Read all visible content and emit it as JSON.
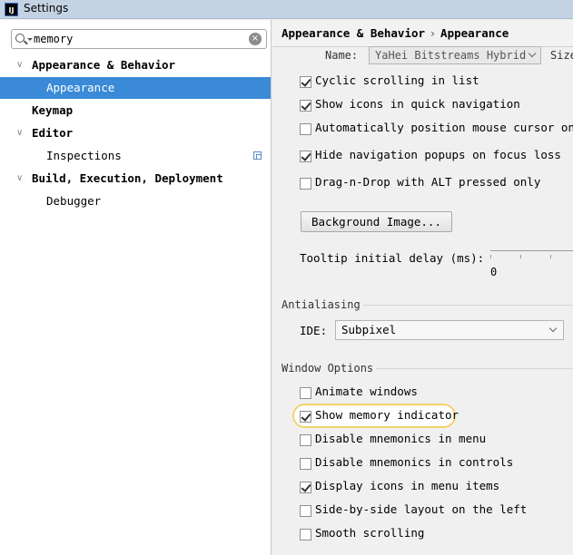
{
  "window": {
    "title": "Settings",
    "app_icon": "IJ"
  },
  "search": {
    "value": "memory"
  },
  "tree": {
    "items": [
      {
        "label": "Appearance & Behavior",
        "arrow": "∨"
      },
      {
        "label": "Appearance"
      },
      {
        "label": "Keymap"
      },
      {
        "label": "Editor",
        "arrow": "∨"
      },
      {
        "label": "Inspections"
      },
      {
        "label": "Build, Execution, Deployment",
        "arrow": "∨"
      },
      {
        "label": "Debugger"
      }
    ]
  },
  "breadcrumb": {
    "parent": "Appearance & Behavior",
    "separator": "›",
    "current": "Appearance"
  },
  "font": {
    "name_label": "Name:",
    "name_value": "YaHei Bitstreams Hybrid",
    "size_label": "Size"
  },
  "ui_options": [
    {
      "label": "Cyclic scrolling in list",
      "checked": true
    },
    {
      "label": "Show icons in quick navigation",
      "checked": true
    },
    {
      "label": "Automatically position mouse cursor on de",
      "checked": false
    },
    {
      "label": "Hide navigation popups on focus loss",
      "checked": true
    },
    {
      "label": "Drag-n-Drop with ALT pressed only",
      "checked": false
    }
  ],
  "background_button": "Background Image...",
  "tooltip": {
    "label": "Tooltip initial delay (ms):",
    "min": "0"
  },
  "antialiasing": {
    "title": "Antialiasing",
    "ide_label": "IDE:",
    "ide_value": "Subpixel"
  },
  "window_options": {
    "title": "Window Options",
    "items": [
      {
        "label": "Animate windows",
        "checked": false
      },
      {
        "label": "Show memory indicator",
        "checked": true,
        "highlighted": true
      },
      {
        "label": "Disable mnemonics in menu",
        "checked": false
      },
      {
        "label": "Disable mnemonics in controls",
        "checked": false
      },
      {
        "label": "Display icons in menu items",
        "checked": true
      },
      {
        "label": "Side-by-side layout on the left",
        "checked": false
      },
      {
        "label": "Smooth scrolling",
        "checked": false
      }
    ]
  },
  "colors": {
    "selection": "#3a8ad7",
    "highlight_ring": "#f2d36b"
  }
}
